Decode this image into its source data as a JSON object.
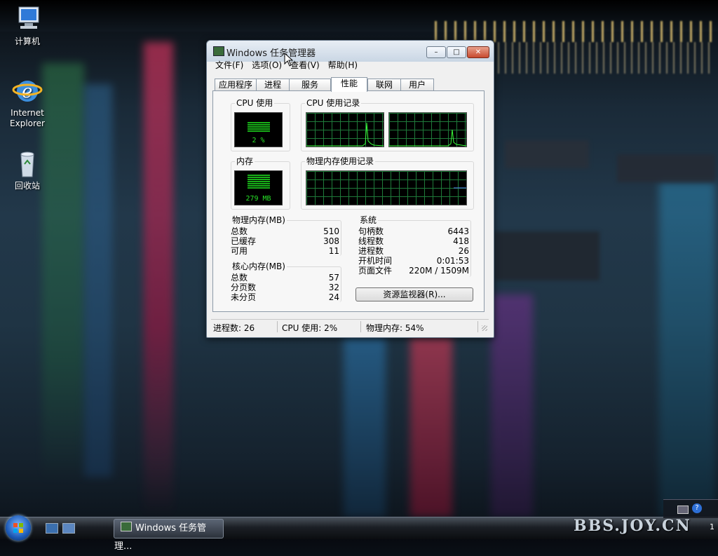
{
  "desktop": {
    "icons": [
      {
        "label": "计算机"
      },
      {
        "label": "Internet\nExplorer"
      },
      {
        "label": "回收站"
      }
    ]
  },
  "window": {
    "title": "Windows 任务管理器",
    "controls": {
      "minimize": "–",
      "maximize": "□",
      "close": "✕"
    },
    "menu": [
      "文件(F)",
      "选项(O)",
      "查看(V)",
      "帮助(H)"
    ],
    "tabs": [
      "应用程序",
      "进程",
      "服务",
      "性能",
      "联网",
      "用户"
    ],
    "active_tab": "性能",
    "cpu_usage": {
      "title": "CPU 使用",
      "value": "2 %"
    },
    "cpu_history": {
      "title": "CPU 使用记录"
    },
    "memory": {
      "title": "内存",
      "value": "279 MB"
    },
    "memory_history": {
      "title": "物理内存使用记录"
    },
    "physical_memory": {
      "title": "物理内存(MB)",
      "rows": [
        {
          "label": "总数",
          "value": "510"
        },
        {
          "label": "已缓存",
          "value": "308"
        },
        {
          "label": "可用",
          "value": "11"
        }
      ]
    },
    "kernel_memory": {
      "title": "核心内存(MB)",
      "rows": [
        {
          "label": "总数",
          "value": "57"
        },
        {
          "label": "分页数",
          "value": "32"
        },
        {
          "label": "未分页",
          "value": "24"
        }
      ]
    },
    "system": {
      "title": "系统",
      "rows": [
        {
          "label": "句柄数",
          "value": "6443"
        },
        {
          "label": "线程数",
          "value": "418"
        },
        {
          "label": "进程数",
          "value": "26"
        },
        {
          "label": "开机时间",
          "value": "0:01:53"
        },
        {
          "label": "页面文件",
          "value": "220M / 1509M"
        }
      ]
    },
    "resource_monitor_button": "资源监视器(R)...",
    "status": {
      "processes": "进程数: 26",
      "cpu": "CPU 使用: 2%",
      "memory": "物理内存: 54%"
    }
  },
  "taskbar": {
    "task_button": "Windows 任务管理...",
    "clock": "1"
  },
  "watermark": "BBS.JOY.CN"
}
